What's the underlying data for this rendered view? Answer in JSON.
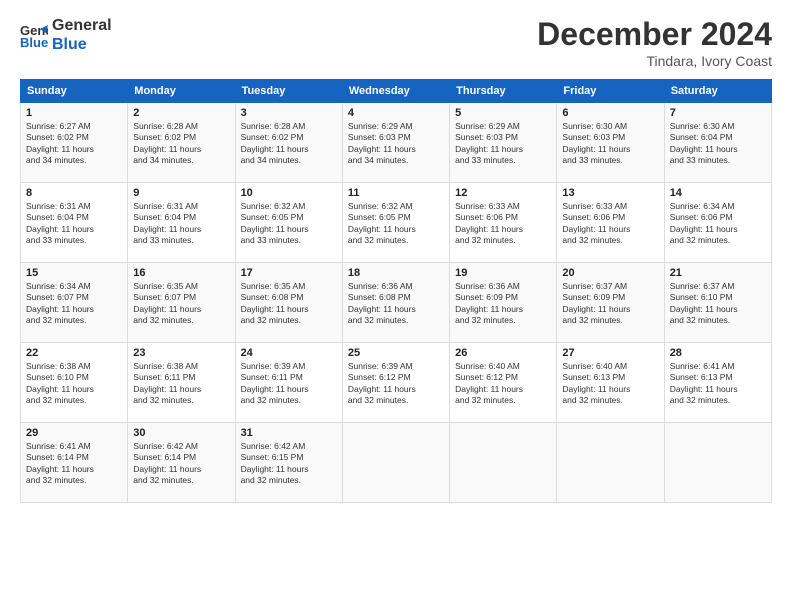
{
  "header": {
    "logo_line1": "General",
    "logo_line2": "Blue",
    "main_title": "December 2024",
    "subtitle": "Tindara, Ivory Coast"
  },
  "calendar": {
    "days_of_week": [
      "Sunday",
      "Monday",
      "Tuesday",
      "Wednesday",
      "Thursday",
      "Friday",
      "Saturday"
    ],
    "weeks": [
      [
        {
          "day": "",
          "info": ""
        },
        {
          "day": "2",
          "info": "Sunrise: 6:28 AM\nSunset: 6:02 PM\nDaylight: 11 hours\nand 34 minutes."
        },
        {
          "day": "3",
          "info": "Sunrise: 6:28 AM\nSunset: 6:02 PM\nDaylight: 11 hours\nand 34 minutes."
        },
        {
          "day": "4",
          "info": "Sunrise: 6:29 AM\nSunset: 6:03 PM\nDaylight: 11 hours\nand 34 minutes."
        },
        {
          "day": "5",
          "info": "Sunrise: 6:29 AM\nSunset: 6:03 PM\nDaylight: 11 hours\nand 33 minutes."
        },
        {
          "day": "6",
          "info": "Sunrise: 6:30 AM\nSunset: 6:03 PM\nDaylight: 11 hours\nand 33 minutes."
        },
        {
          "day": "7",
          "info": "Sunrise: 6:30 AM\nSunset: 6:04 PM\nDaylight: 11 hours\nand 33 minutes."
        }
      ],
      [
        {
          "day": "8",
          "info": "Sunrise: 6:31 AM\nSunset: 6:04 PM\nDaylight: 11 hours\nand 33 minutes."
        },
        {
          "day": "9",
          "info": "Sunrise: 6:31 AM\nSunset: 6:04 PM\nDaylight: 11 hours\nand 33 minutes."
        },
        {
          "day": "10",
          "info": "Sunrise: 6:32 AM\nSunset: 6:05 PM\nDaylight: 11 hours\nand 33 minutes."
        },
        {
          "day": "11",
          "info": "Sunrise: 6:32 AM\nSunset: 6:05 PM\nDaylight: 11 hours\nand 32 minutes."
        },
        {
          "day": "12",
          "info": "Sunrise: 6:33 AM\nSunset: 6:06 PM\nDaylight: 11 hours\nand 32 minutes."
        },
        {
          "day": "13",
          "info": "Sunrise: 6:33 AM\nSunset: 6:06 PM\nDaylight: 11 hours\nand 32 minutes."
        },
        {
          "day": "14",
          "info": "Sunrise: 6:34 AM\nSunset: 6:06 PM\nDaylight: 11 hours\nand 32 minutes."
        }
      ],
      [
        {
          "day": "15",
          "info": "Sunrise: 6:34 AM\nSunset: 6:07 PM\nDaylight: 11 hours\nand 32 minutes."
        },
        {
          "day": "16",
          "info": "Sunrise: 6:35 AM\nSunset: 6:07 PM\nDaylight: 11 hours\nand 32 minutes."
        },
        {
          "day": "17",
          "info": "Sunrise: 6:35 AM\nSunset: 6:08 PM\nDaylight: 11 hours\nand 32 minutes."
        },
        {
          "day": "18",
          "info": "Sunrise: 6:36 AM\nSunset: 6:08 PM\nDaylight: 11 hours\nand 32 minutes."
        },
        {
          "day": "19",
          "info": "Sunrise: 6:36 AM\nSunset: 6:09 PM\nDaylight: 11 hours\nand 32 minutes."
        },
        {
          "day": "20",
          "info": "Sunrise: 6:37 AM\nSunset: 6:09 PM\nDaylight: 11 hours\nand 32 minutes."
        },
        {
          "day": "21",
          "info": "Sunrise: 6:37 AM\nSunset: 6:10 PM\nDaylight: 11 hours\nand 32 minutes."
        }
      ],
      [
        {
          "day": "22",
          "info": "Sunrise: 6:38 AM\nSunset: 6:10 PM\nDaylight: 11 hours\nand 32 minutes."
        },
        {
          "day": "23",
          "info": "Sunrise: 6:38 AM\nSunset: 6:11 PM\nDaylight: 11 hours\nand 32 minutes."
        },
        {
          "day": "24",
          "info": "Sunrise: 6:39 AM\nSunset: 6:11 PM\nDaylight: 11 hours\nand 32 minutes."
        },
        {
          "day": "25",
          "info": "Sunrise: 6:39 AM\nSunset: 6:12 PM\nDaylight: 11 hours\nand 32 minutes."
        },
        {
          "day": "26",
          "info": "Sunrise: 6:40 AM\nSunset: 6:12 PM\nDaylight: 11 hours\nand 32 minutes."
        },
        {
          "day": "27",
          "info": "Sunrise: 6:40 AM\nSunset: 6:13 PM\nDaylight: 11 hours\nand 32 minutes."
        },
        {
          "day": "28",
          "info": "Sunrise: 6:41 AM\nSunset: 6:13 PM\nDaylight: 11 hours\nand 32 minutes."
        }
      ],
      [
        {
          "day": "29",
          "info": "Sunrise: 6:41 AM\nSunset: 6:14 PM\nDaylight: 11 hours\nand 32 minutes."
        },
        {
          "day": "30",
          "info": "Sunrise: 6:42 AM\nSunset: 6:14 PM\nDaylight: 11 hours\nand 32 minutes."
        },
        {
          "day": "31",
          "info": "Sunrise: 6:42 AM\nSunset: 6:15 PM\nDaylight: 11 hours\nand 32 minutes."
        },
        {
          "day": "",
          "info": ""
        },
        {
          "day": "",
          "info": ""
        },
        {
          "day": "",
          "info": ""
        },
        {
          "day": "",
          "info": ""
        }
      ]
    ],
    "week1_day1": {
      "day": "1",
      "info": "Sunrise: 6:27 AM\nSunset: 6:02 PM\nDaylight: 11 hours\nand 34 minutes."
    }
  }
}
